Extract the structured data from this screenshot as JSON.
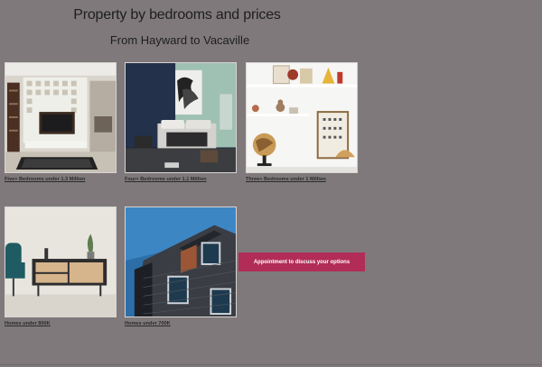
{
  "header": {
    "title": "Property by bedrooms and prices",
    "subtitle": "From Hayward to Vacaville"
  },
  "listings": [
    {
      "caption": "Five+ Bedrooms under 1.3 Million",
      "image": "living-room-photo"
    },
    {
      "caption": "Four+ Bedrooms under 1.1 Million",
      "image": "bedroom-photo"
    },
    {
      "caption": "Three+ Bedrooms under 1 Million",
      "image": "shelf-decor-photo"
    },
    {
      "caption": "Homes under 800K",
      "image": "sideboard-photo"
    },
    {
      "caption": "Homes under 700K",
      "image": "building-facade-photo"
    }
  ],
  "cta": {
    "label": "Appointment  to discuss your options",
    "color": "#b12d57"
  },
  "colors": {
    "background": "#7f797c"
  }
}
